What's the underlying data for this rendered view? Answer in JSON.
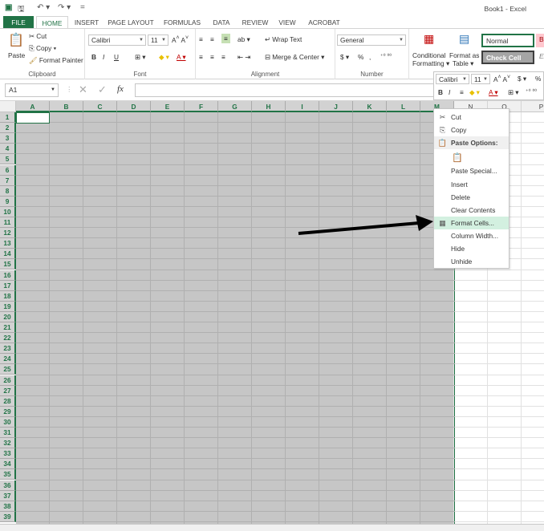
{
  "window": {
    "title": "Book1 - Excel"
  },
  "quick_access": {
    "excel_icon": "excel-logo-icon",
    "save_icon": "save-icon",
    "undo_icon": "undo-icon",
    "redo_icon": "redo-icon",
    "more": "="
  },
  "tabs": [
    "FILE",
    "HOME",
    "INSERT",
    "PAGE LAYOUT",
    "FORMULAS",
    "DATA",
    "REVIEW",
    "VIEW",
    "ACROBAT"
  ],
  "active_tab": "HOME",
  "clipboard": {
    "paste": "Paste",
    "cut": "Cut",
    "copy": "Copy",
    "format_painter": "Format Painter",
    "label": "Clipboard"
  },
  "font": {
    "name": "Calibri",
    "size": "11",
    "bold": "B",
    "italic": "I",
    "underline": "U",
    "label": "Font"
  },
  "alignment": {
    "wrap": "Wrap Text",
    "merge": "Merge & Center",
    "label": "Alignment"
  },
  "number": {
    "format": "General",
    "currency": "$",
    "percent": "%",
    "comma": ",",
    "label": "Number"
  },
  "styles": {
    "conditional": "Conditional",
    "conditional2": "Formatting",
    "format_as": "Format as",
    "format_as2": "Table",
    "normal": "Normal",
    "bad": "Ba",
    "check_cell": "Check Cell",
    "explanatory": "Ex"
  },
  "formula_bar": {
    "name_box": "A1",
    "fx": "fx"
  },
  "columns": [
    "A",
    "B",
    "C",
    "D",
    "E",
    "F",
    "G",
    "H",
    "I",
    "J",
    "K",
    "L",
    "M",
    "N",
    "O",
    "P"
  ],
  "rows": [
    "1",
    "2",
    "3",
    "4",
    "5",
    "6",
    "7",
    "8",
    "9",
    "10",
    "11",
    "12",
    "13",
    "14",
    "15",
    "16",
    "17",
    "18",
    "19",
    "20",
    "21",
    "22",
    "23",
    "24",
    "25",
    "26",
    "27",
    "28",
    "29",
    "30",
    "31",
    "32",
    "33",
    "34",
    "35",
    "36",
    "37",
    "38",
    "39"
  ],
  "mini_toolbar": {
    "font": "Calibri",
    "size": "11",
    "currency": "$",
    "percent": "%",
    "bold": "B",
    "italic": "I"
  },
  "context_menu": {
    "cut": "Cut",
    "copy": "Copy",
    "paste_options": "Paste Options:",
    "paste_special": "Paste Special...",
    "insert": "Insert",
    "delete": "Delete",
    "clear_contents": "Clear Contents",
    "format_cells": "Format Cells...",
    "column_width": "Column Width...",
    "hide": "Hide",
    "unhide": "Unhide"
  },
  "accent_color": "#217346"
}
